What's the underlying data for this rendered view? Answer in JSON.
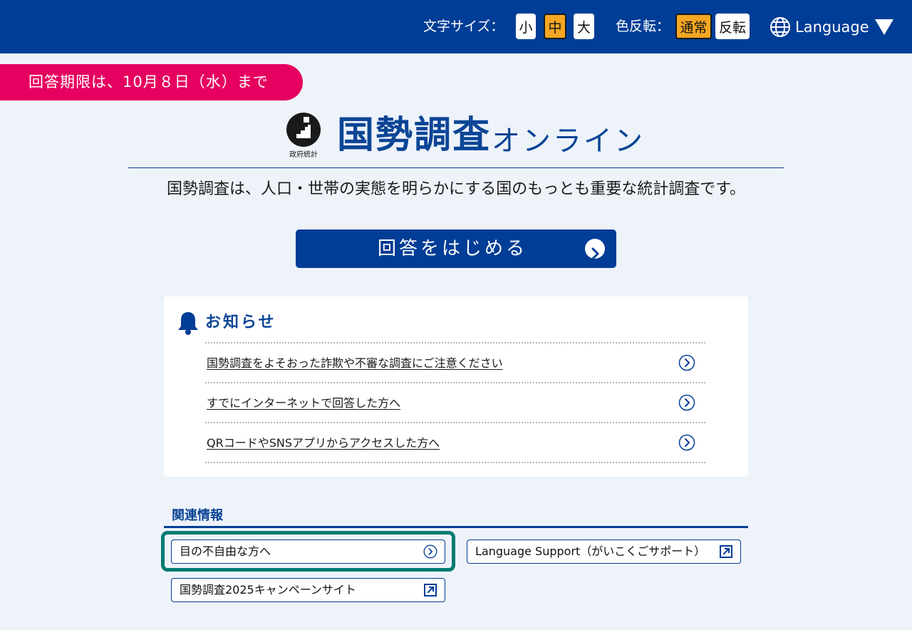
{
  "header": {
    "font_size_label": "文字サイズ：",
    "font_sizes": [
      "小",
      "中",
      "大"
    ],
    "font_size_selected": "中",
    "color_label": "色反転：",
    "color_modes": [
      "通常",
      "反転"
    ],
    "color_selected": "通常",
    "language_label": "Language"
  },
  "deadline": "回答期限は、10月８日（水）まで",
  "logo": {
    "caption": "政府統計",
    "title_main": "国勢調査",
    "title_sub": "オンライン"
  },
  "tagline": "国勢調査は、人口・世帯の実態を明らかにする国のもっとも重要な統計調査です。",
  "start_button": "回答をはじめる",
  "notices": {
    "title": "お知らせ",
    "items": [
      "国勢調査をよそおった詐欺や不審な調査にご注意ください",
      "すでにインターネットで回答した方へ",
      "QRコードやSNSアプリからアクセスした方へ"
    ]
  },
  "related": {
    "title": "関連情報",
    "links": [
      {
        "label": "目の不自由な方へ",
        "icon": "chevron-right-icon"
      },
      {
        "label": "Language Support（がいこくごサポート）",
        "icon": "external-link-icon"
      },
      {
        "label": "国勢調査2025キャンペーンサイト",
        "icon": "external-link-icon"
      }
    ]
  },
  "colors": {
    "header_bg": "#003d96",
    "deadline_bg": "#e6005f",
    "active_option": "#f5a623",
    "focus_ring": "#007a72"
  }
}
